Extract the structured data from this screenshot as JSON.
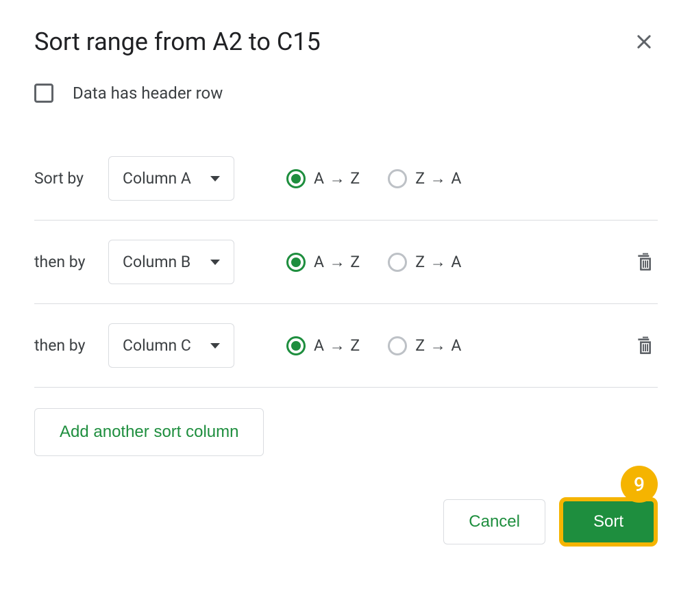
{
  "title": "Sort range from A2 to C15",
  "header_checkbox_label": "Data has header row",
  "sort_rows": [
    {
      "label": "Sort by",
      "selected_column": "Column A",
      "az_label": "A → Z",
      "za_label": "Z → A",
      "has_delete": false
    },
    {
      "label": "then by",
      "selected_column": "Column B",
      "az_label": "A → Z",
      "za_label": "Z → A",
      "has_delete": true
    },
    {
      "label": "then by",
      "selected_column": "Column C",
      "az_label": "A → Z",
      "za_label": "Z → A",
      "has_delete": true
    }
  ],
  "add_column_label": "Add another sort column",
  "cancel_label": "Cancel",
  "sort_label": "Sort",
  "badge_number": "9"
}
